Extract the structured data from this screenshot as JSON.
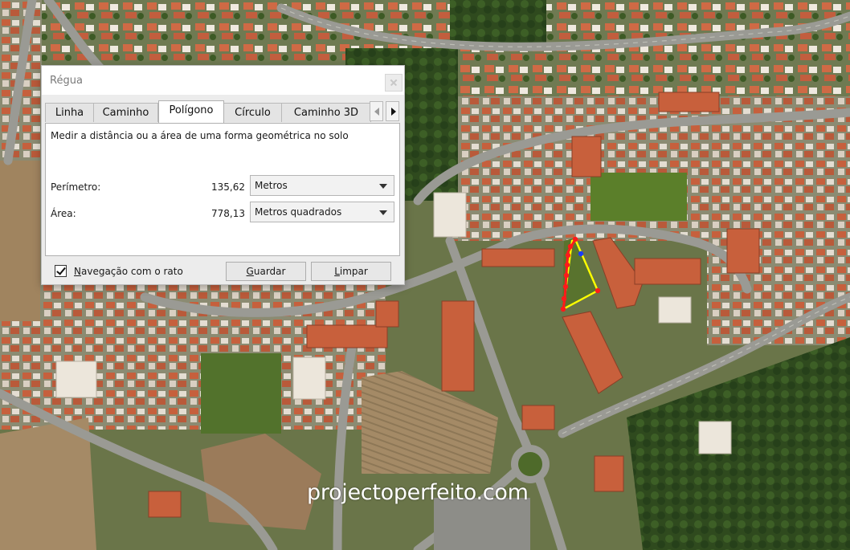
{
  "window": {
    "title": "Régua",
    "close_icon": "close-icon"
  },
  "tabs": [
    {
      "label": "Linha",
      "active": false
    },
    {
      "label": "Caminho",
      "active": false
    },
    {
      "label": "Polígono",
      "active": true
    },
    {
      "label": "Círculo",
      "active": false
    },
    {
      "label": "Caminho 3D",
      "active": false
    }
  ],
  "tab_scroll": {
    "left_icon": "chevron-left-icon",
    "right_icon": "chevron-right-icon"
  },
  "panel": {
    "description": "Medir a distância ou a área de uma forma geométrica no solo",
    "perimeter": {
      "label": "Perímetro:",
      "value": "135,62",
      "unit": "Metros"
    },
    "area": {
      "label": "Área:",
      "value": "778,13",
      "unit": "Metros quadrados"
    }
  },
  "footer": {
    "mouse_nav_label": "Navegação com o rato",
    "mouse_nav_checked": true,
    "save_label": "Guardar",
    "clear_label": "Limpar"
  },
  "map": {
    "watermark": "projectoperfeito.com",
    "polygon_edge_color": "#ffff00",
    "polygon_vertex_color": "#ff1a1a",
    "active_vertex_color": "#1a3cff"
  }
}
